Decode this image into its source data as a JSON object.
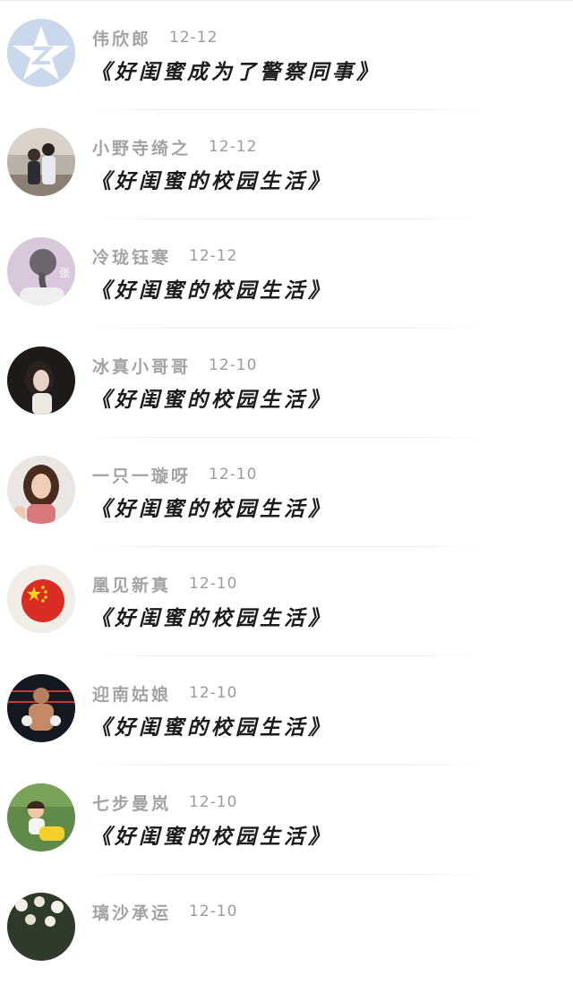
{
  "comments": [
    {
      "name": "伟欣郎",
      "date": "12-12",
      "title": "《好闺蜜成为了警察同事》",
      "avatar": "qq-default-avatar-icon"
    },
    {
      "name": "小野寺绮之",
      "date": "12-12",
      "title": "《好闺蜜的校园生活》",
      "avatar": "couple-photo"
    },
    {
      "name": "冷珑钰寒",
      "date": "12-12",
      "title": "《好闺蜜的校园生活》",
      "avatar": "braid-hair-photo"
    },
    {
      "name": "冰真小哥哥",
      "date": "12-10",
      "title": "《好闺蜜的校园生活》",
      "avatar": "girl-portrait-photo"
    },
    {
      "name": "一只一璇呀",
      "date": "12-10",
      "title": "《好闺蜜的校园生活》",
      "avatar": "smiling-girl-photo"
    },
    {
      "name": "凰见新真",
      "date": "12-10",
      "title": "《好闺蜜的校园生活》",
      "avatar": "china-flag-badge"
    },
    {
      "name": "迎南姑娘",
      "date": "12-10",
      "title": "《好闺蜜的校园生活》",
      "avatar": "boxer-photo"
    },
    {
      "name": "七步曼岚",
      "date": "12-10",
      "title": "《好闺蜜的校园生活》",
      "avatar": "child-photo"
    },
    {
      "name": "璃沙承运",
      "date": "12-10",
      "title": "",
      "avatar": "floral-photo"
    }
  ]
}
